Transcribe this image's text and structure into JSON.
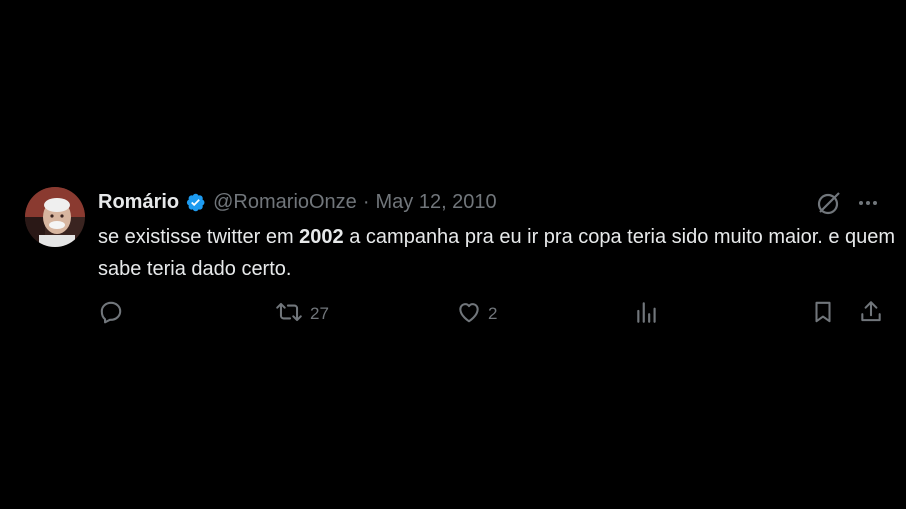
{
  "tweet": {
    "author_name": "Romário",
    "handle": "@RomarioOnze",
    "separator": "·",
    "date": "May 12, 2010",
    "text_before": "se existisse twitter em ",
    "text_year": "2002",
    "text_after": " a campanha pra eu ir pra copa teria sido muito maior. e quem sabe teria dado certo.",
    "verified": true
  },
  "actions": {
    "reply_count": "",
    "retweet_count": "27",
    "like_count": "2",
    "views_count": ""
  },
  "colors": {
    "background": "#000000",
    "text": "#e7e9ea",
    "muted": "#71767b",
    "verified_blue": "#1d9bf0"
  },
  "icons": [
    "grok-icon",
    "more-icon",
    "reply-icon",
    "retweet-icon",
    "like-icon",
    "views-icon",
    "bookmark-icon",
    "share-icon",
    "verified-badge-icon"
  ]
}
